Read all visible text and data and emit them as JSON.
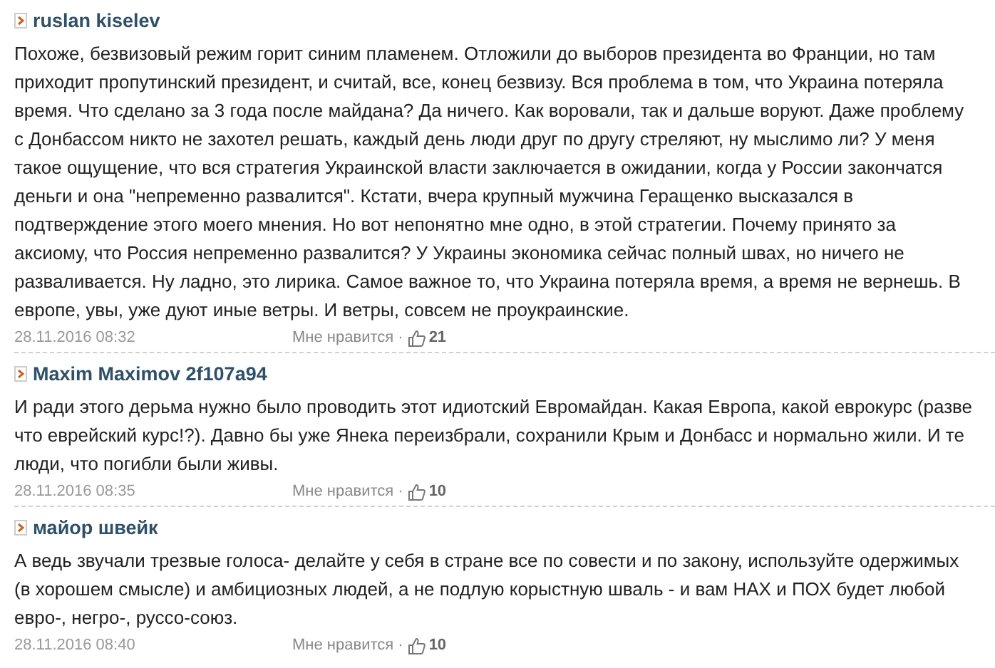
{
  "comments": [
    {
      "author": "ruslan kiselev",
      "text": "Похоже, безвизовый режим горит синим пламенем. Отложили до выборов президента во Франции, но там приходит пропутинский президент, и считай, все, конец безвизу. Вся проблема в том, что Украина потеряла время. Что сделано за 3 года после майдана? Да ничего. Как воровали, так и дальше воруют. Даже проблему с Донбассом никто не захотел решать, каждый день люди друг по другу стреляют, ну мыслимо ли? У меня такое ощущение, что вся стратегия Украинской власти заключается в ожидании, когда у России закончатся деньги и она \"непременно развалится\". Кстати, вчера крупный мужчина Геращенко высказался в подтверждение этого моего мнения. Но вот непонятно мне одно, в этой стратегии. Почему принято за аксиому, что Россия непременно развалится? У Украины экономика сейчас полный швах, но ничего не разваливается. Ну ладно, это лирика. Самое важное то, что Украина потеряла время, а время не вернешь. В европе, увы, уже дуют иные ветры. И ветры, совсем не проукраинские.",
      "date": "28.11.2016 08:32",
      "like_label": "Мне нравится ·",
      "likes": "21"
    },
    {
      "author": "Maxim Maximov 2f107a94",
      "text": "И ради этого дерьма нужно было проводить этот идиотский Евромайдан. Какая Европа, какой еврокурс (разве что еврейский курс!?). Давно бы уже Янека переизбрали, сохранили Крым и Донбасс и нормально жили. И те люди, что погибли были живы.",
      "date": "28.11.2016 08:35",
      "like_label": "Мне нравится ·",
      "likes": "10"
    },
    {
      "author": "майор швейк",
      "text": "А ведь звучали трезвые голоса- делайте у себя в стране все по совести и по закону, используйте одержимых (в хорошем смысле) и амбициозных людей, а не подлую корыстную шваль - и вам НАХ и ПОХ будет любой евро-, негро-, руссо-союз.",
      "date": "28.11.2016 08:40",
      "like_label": "Мне нравится ·",
      "likes": "10"
    }
  ]
}
